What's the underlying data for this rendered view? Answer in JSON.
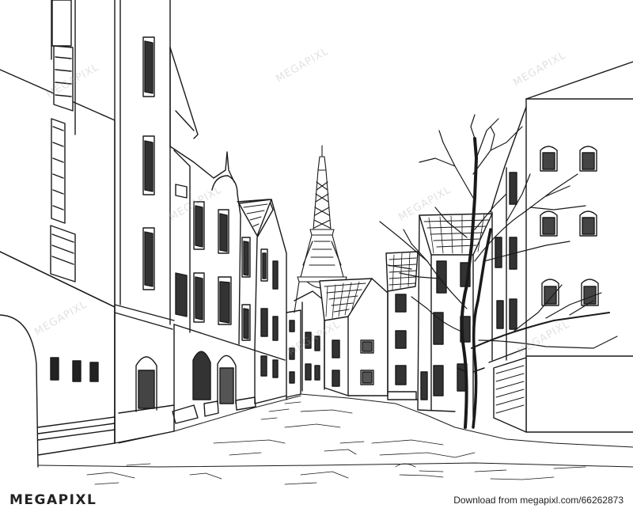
{
  "watermark": {
    "text": "MEGAPIXL"
  },
  "footer": {
    "brand": "MEGAPIXL",
    "credit": "Download from megapixl.com/66262873"
  },
  "colors": {
    "ink": "#1a1a1a",
    "paper": "#ffffff",
    "watermark": "#bbbbbb"
  },
  "scene": {
    "subject": "Eiffel Tower street sketch"
  }
}
